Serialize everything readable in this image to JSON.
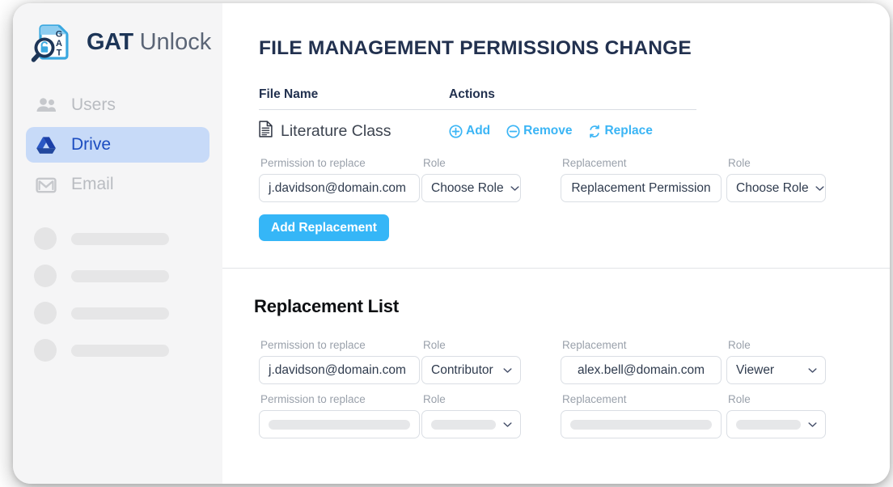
{
  "brand": {
    "name_bold": "GAT",
    "name_light": "Unlock",
    "logo_icon": "gat-document-lock-logo",
    "logo_letters": [
      "G",
      "A",
      "T"
    ]
  },
  "sidebar": {
    "items": [
      {
        "label": "Users",
        "icon": "users-icon",
        "active": false
      },
      {
        "label": "Drive",
        "icon": "google-drive-icon",
        "active": true
      },
      {
        "label": "Email",
        "icon": "gmail-icon",
        "active": false
      }
    ],
    "skeleton_rows": 4
  },
  "header": {
    "title": "FILE MANAGEMENT PERMISSIONS CHANGE"
  },
  "file_table": {
    "columns": [
      "File Name",
      "Actions"
    ],
    "rows": [
      {
        "file_icon": "document-icon",
        "file_name": "Literature Class",
        "actions": [
          {
            "label": "Add",
            "icon": "circle-plus-icon"
          },
          {
            "label": "Remove",
            "icon": "circle-minus-icon"
          },
          {
            "label": "Replace",
            "icon": "refresh-icon"
          }
        ]
      }
    ]
  },
  "replace_form": {
    "fields": {
      "permission_label": "Permission to replace",
      "permission_value": "j.davidson@domain.com",
      "role_label": "Role",
      "role_value": "Choose Role",
      "replacement_label": "Replacement",
      "replacement_value": "Replacement Permission",
      "replacement_role_label": "Role",
      "replacement_role_value": "Choose Role"
    },
    "submit_label": "Add Replacement"
  },
  "replacement_list": {
    "title": "Replacement List",
    "rows": [
      {
        "permission_label": "Permission to replace",
        "permission_value": "j.davidson@domain.com",
        "role_label": "Role",
        "role_value": "Contributor",
        "replacement_label": "Replacement",
        "replacement_value": "alex.bell@domain.com",
        "replacement_role_label": "Role",
        "replacement_role_value": "Viewer",
        "placeholder": false
      },
      {
        "permission_label": "Permission to replace",
        "permission_value": "",
        "role_label": "Role",
        "role_value": "",
        "replacement_label": "Replacement",
        "replacement_value": "",
        "replacement_role_label": "Role",
        "replacement_role_value": "",
        "placeholder": true
      }
    ]
  },
  "colors": {
    "accent_blue": "#35b6f7",
    "drive_active_bg": "#c7daf8",
    "drive_active_text": "#1b4cc0",
    "title_navy": "#22314f",
    "sidebar_bg": "#f5f5f6",
    "muted_label": "#9aa1ab"
  }
}
